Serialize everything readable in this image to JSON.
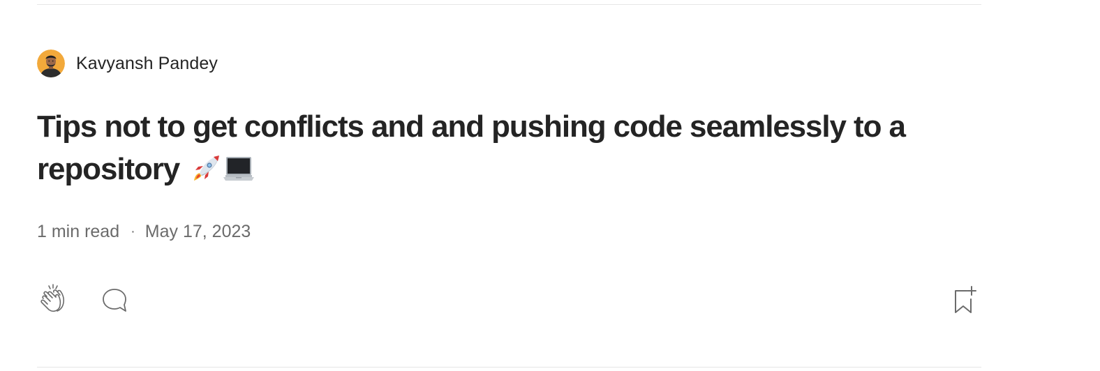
{
  "author": {
    "name": "Kavyansh Pandey",
    "avatar_bg": "#f2a93b"
  },
  "post": {
    "title": "Tips not to get conflicts and and pushing code seamlessly to a repository",
    "title_emojis": [
      "rocket-emoji",
      "laptop-emoji"
    ],
    "read_time": "1 min read",
    "separator": "·",
    "date": "May 17, 2023"
  },
  "actions": {
    "clap_icon": "clap-icon",
    "respond_icon": "speech-bubble-icon",
    "bookmark_icon": "bookmark-add-icon"
  }
}
